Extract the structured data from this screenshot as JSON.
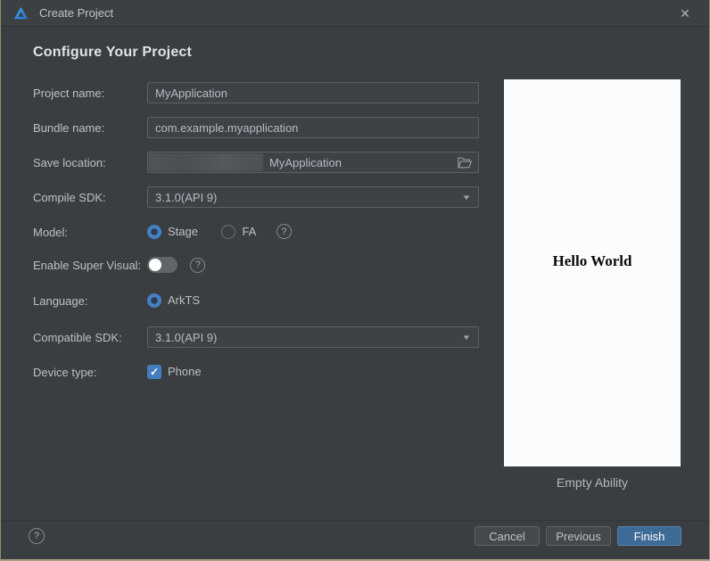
{
  "window": {
    "title": "Create Project",
    "close_glyph": "✕"
  },
  "header": {
    "title": "Configure Your Project"
  },
  "form": {
    "project_name": {
      "label": "Project name:",
      "value": "MyApplication"
    },
    "bundle_name": {
      "label": "Bundle name:",
      "value": "com.example.myapplication"
    },
    "save_location": {
      "label": "Save location:",
      "value": "MyApplication"
    },
    "compile_sdk": {
      "label": "Compile SDK:",
      "value": "3.1.0(API 9)"
    },
    "model": {
      "label": "Model:",
      "options": [
        "Stage",
        "FA"
      ],
      "selected": "Stage"
    },
    "enable_super_visual": {
      "label": "Enable Super Visual:",
      "enabled": false
    },
    "language": {
      "label": "Language:",
      "options": [
        "ArkTS"
      ],
      "selected": "ArkTS"
    },
    "compatible_sdk": {
      "label": "Compatible SDK:",
      "value": "3.1.0(API 9)"
    },
    "device_type": {
      "label": "Device type:",
      "options": [
        "Phone"
      ],
      "checked": [
        "Phone"
      ],
      "check_glyph": "✓"
    }
  },
  "preview": {
    "screen_text": "Hello World",
    "caption": "Empty Ability"
  },
  "footer": {
    "cancel_label": "Cancel",
    "previous_label": "Previous",
    "finish_label": "Finish"
  },
  "icons": {
    "help_glyph": "?",
    "caret_glyph": "▼"
  },
  "colors": {
    "accent_blue": "#4580c2",
    "checkbox_blue": "#447dc0",
    "finish_button": "#3e6a96",
    "window_bg": "#3b3e40",
    "preview_bg": "#fcfcfc"
  }
}
